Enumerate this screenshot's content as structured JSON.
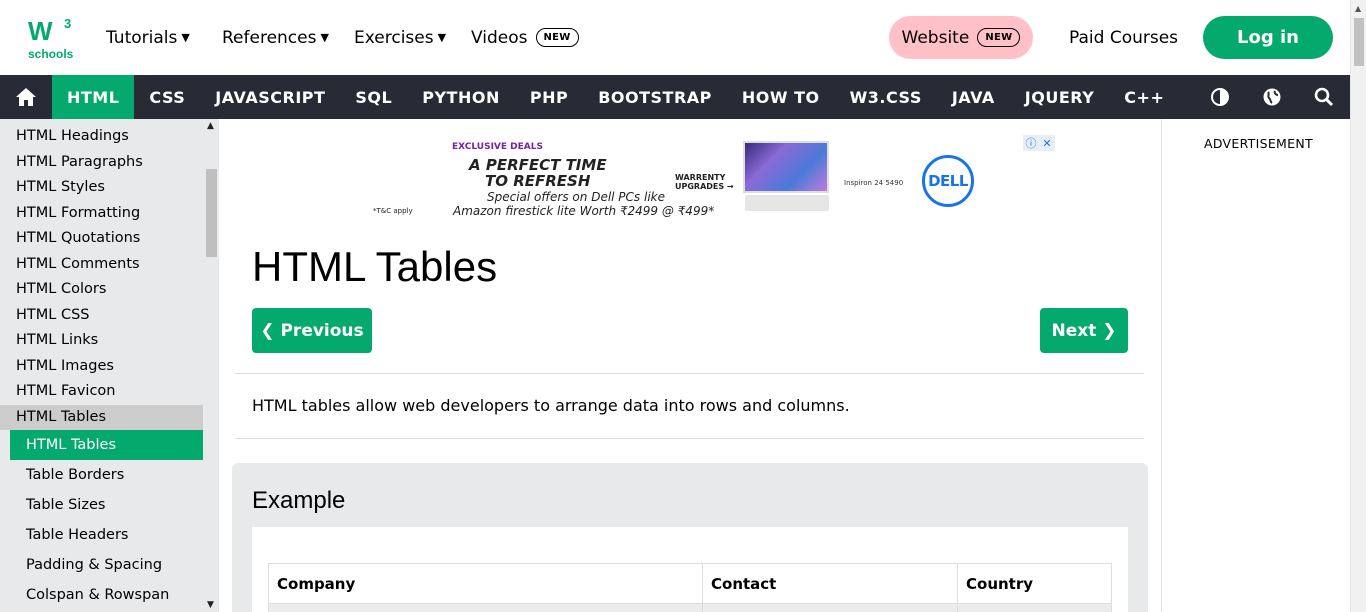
{
  "brand": {
    "logo_text": "schools",
    "logo_mark": "W3"
  },
  "topnav": {
    "tutorials": "Tutorials",
    "references": "References",
    "exercises": "Exercises",
    "videos": "Videos",
    "new_badge": "NEW",
    "website": "Website",
    "paid_courses": "Paid Courses",
    "login": "Log in"
  },
  "darknav": {
    "items": [
      "HTML",
      "CSS",
      "JAVASCRIPT",
      "SQL",
      "PYTHON",
      "PHP",
      "BOOTSTRAP",
      "HOW TO",
      "W3.CSS",
      "JAVA",
      "JQUERY",
      "C++"
    ],
    "active": "HTML",
    "icons": [
      "home-icon",
      "contrast-icon",
      "globe-icon",
      "search-icon"
    ]
  },
  "sidebar": {
    "links": [
      "HTML Headings",
      "HTML Paragraphs",
      "HTML Styles",
      "HTML Formatting",
      "HTML Quotations",
      "HTML Comments",
      "HTML Colors",
      "HTML CSS",
      "HTML Links",
      "HTML Images",
      "HTML Favicon",
      "HTML Tables"
    ],
    "sub": [
      "HTML Tables",
      "Table Borders",
      "Table Sizes",
      "Table Headers",
      "Padding & Spacing",
      "Colspan & Rowspan"
    ]
  },
  "ad": {
    "deal": "EXCLUSIVE DEALS",
    "headline1": "A PERFECT TIME",
    "headline2": "TO REFRESH",
    "offer1": "Special offers on Dell PCs like",
    "offer2": "Amazon firestick lite Worth ₹2499 @ ₹499*",
    "tc": "*T&C apply",
    "warranty": "WARRENTY\nUPGRADES",
    "model": "Inspiron 24 5490",
    "brand": "DELL"
  },
  "main": {
    "title": "HTML Tables",
    "prev": "❮ Previous",
    "next": "Next ❯",
    "intro": "HTML tables allow web developers to arrange data into rows and columns.",
    "example_title": "Example",
    "table_headers": [
      "Company",
      "Contact",
      "Country"
    ]
  },
  "right": {
    "ad_label": "ADVERTISEMENT"
  },
  "colors": {
    "accent": "#04aa6d",
    "nav_dark": "#282a35",
    "website_pink": "#ffc0c7",
    "sidebar_bg": "#e7e9eb"
  }
}
